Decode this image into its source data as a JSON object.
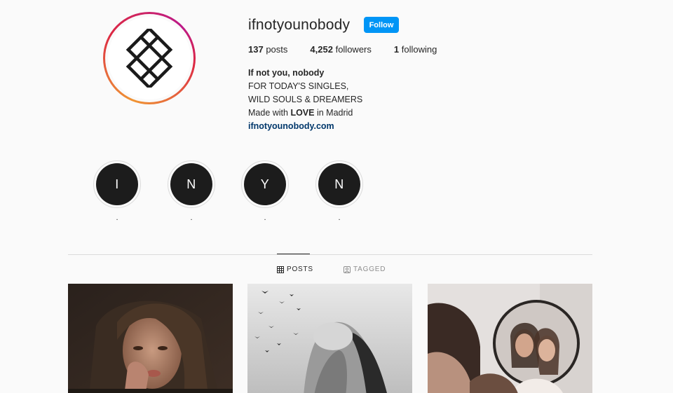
{
  "profile": {
    "username": "ifnotyounobody",
    "follow_label": "Follow",
    "avatar_icon": "crosshatch-logo-icon"
  },
  "stats": [
    {
      "count": "137",
      "label": "posts"
    },
    {
      "count": "4,252",
      "label": "followers"
    },
    {
      "count": "1",
      "label": "following"
    }
  ],
  "bio": {
    "name": "If not you, nobody",
    "line1": "FOR TODAY'S SINGLES,",
    "line2": "WILD SOULS & DREAMERS",
    "line3_pre": "Made with ",
    "line3_bold": "LOVE",
    "line3_post": " in Madrid",
    "link": "ifnotyounobody.com"
  },
  "highlights": [
    {
      "letter": "I",
      "label": "."
    },
    {
      "letter": "N",
      "label": "."
    },
    {
      "letter": "Y",
      "label": "."
    },
    {
      "letter": "N",
      "label": "."
    }
  ],
  "tabs": {
    "posts": "POSTS",
    "tagged": "TAGGED"
  },
  "colors": {
    "accent": "#0095f6",
    "link": "#00376b",
    "highlight_bg": "#1c1c1c"
  }
}
